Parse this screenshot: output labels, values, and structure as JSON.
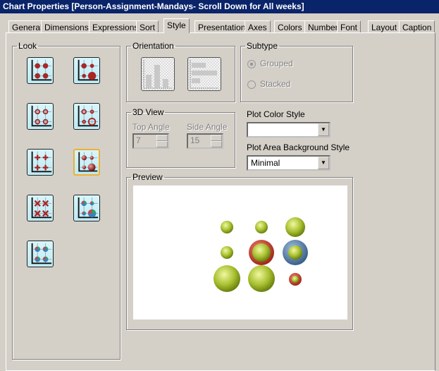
{
  "window": {
    "title": "Chart Properties [Person-Assignment-Mandays- Scroll Down for All weeks]"
  },
  "tabs": [
    {
      "label": "General"
    },
    {
      "label": "Dimensions"
    },
    {
      "label": "Expressions"
    },
    {
      "label": "Sort"
    },
    {
      "label": "Style",
      "active": true
    },
    {
      "label": "Presentation"
    },
    {
      "label": "Axes"
    },
    {
      "label": "Colors"
    },
    {
      "label": "Number"
    },
    {
      "label": "Font"
    },
    {
      "label": "Layout"
    },
    {
      "label": "Caption"
    }
  ],
  "look": {
    "label": "Look",
    "selected": "3d-balls-varied",
    "options": [
      "solid-dots",
      "solid-dots-varied",
      "rings",
      "rings-varied",
      "plus",
      "3d-balls-varied",
      "crosses",
      "pie-bubbles-varied",
      "pie-bubbles"
    ]
  },
  "orientation": {
    "label": "Orientation",
    "options": [
      "vertical",
      "horizontal"
    ]
  },
  "subtype": {
    "label": "Subtype",
    "options": [
      {
        "label": "Grouped",
        "checked": true,
        "disabled": true
      },
      {
        "label": "Stacked",
        "checked": false,
        "disabled": true
      }
    ]
  },
  "view3d": {
    "label": "3D View",
    "top_angle_label": "Top Angle",
    "top_angle": "7",
    "side_angle_label": "Side Angle",
    "side_angle": "15"
  },
  "plot_color_style": {
    "label": "Plot Color Style",
    "value": ""
  },
  "plot_bg_style": {
    "label": "Plot Area Background Style",
    "value": "Minimal"
  },
  "preview": {
    "label": "Preview"
  },
  "colors": {
    "titlebar": "#0a246a",
    "bubble_green": "#a8c030",
    "bubble_red": "#c0392b",
    "bubble_blue": "#5a7fa8"
  }
}
